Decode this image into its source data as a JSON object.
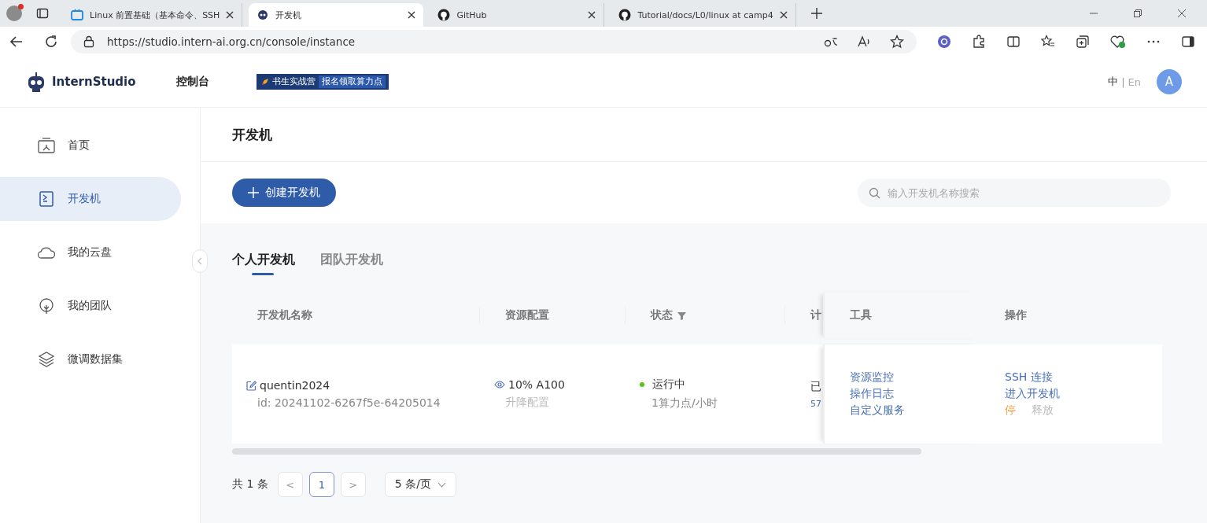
{
  "browser": {
    "tabs": [
      {
        "title": "Linux 前置基础（基本命令、SSH",
        "selected": false
      },
      {
        "title": "开发机",
        "selected": true
      },
      {
        "title": "GitHub",
        "selected": false
      },
      {
        "title": "Tutorial/docs/L0/linux at camp4",
        "selected": false
      }
    ],
    "url": "https://studio.intern-ai.org.cn/console/instance"
  },
  "header": {
    "logo": "InternStudio",
    "nav": "控制台",
    "banner": {
      "tag": "书生实战营",
      "text": "报名领取算力点"
    },
    "lang": {
      "zh": "中",
      "separator": "|",
      "en": "En"
    },
    "avatar": "A"
  },
  "sidebar": {
    "items": [
      {
        "label": "首页",
        "selected": false
      },
      {
        "label": "开发机",
        "selected": true
      },
      {
        "label": "我的云盘",
        "selected": false
      },
      {
        "label": "我的团队",
        "selected": false
      },
      {
        "label": "微调数据集",
        "selected": false
      }
    ]
  },
  "page": {
    "title": "开发机",
    "create_button": "创建开发机",
    "search": {
      "placeholder": "输入开发机名称搜索"
    },
    "tabs": [
      {
        "label": "个人开发机",
        "selected": true
      },
      {
        "label": "团队开发机",
        "selected": false
      }
    ]
  },
  "table": {
    "columns": [
      "开发机名称",
      "资源配置",
      "状态",
      "计",
      "工具",
      "操作"
    ],
    "rows": [
      {
        "name": "quentin2024",
        "id": "id: 20241102-6267f5e-64205014",
        "resource": "10% A100",
        "resource_action": "升降配置",
        "status": "运行中",
        "rate": "1算力点/小时",
        "column_4": [
          "已",
          "57"
        ],
        "tools": [
          "资源监控",
          "操作日志",
          "自定义服务"
        ],
        "actions": [
          {
            "label": "SSH 连接",
            "kind": "link"
          },
          {
            "label": "进入开发机",
            "kind": "link"
          },
          {
            "label": "停",
            "kind": "warn"
          },
          {
            "label": "释放",
            "kind": "disabled"
          }
        ]
      }
    ]
  },
  "pagination": {
    "total": "共 1 条",
    "prev": "<",
    "pages": [
      {
        "label": "1",
        "selected": true
      }
    ],
    "next": ">",
    "page_size": "5 条/页"
  }
}
